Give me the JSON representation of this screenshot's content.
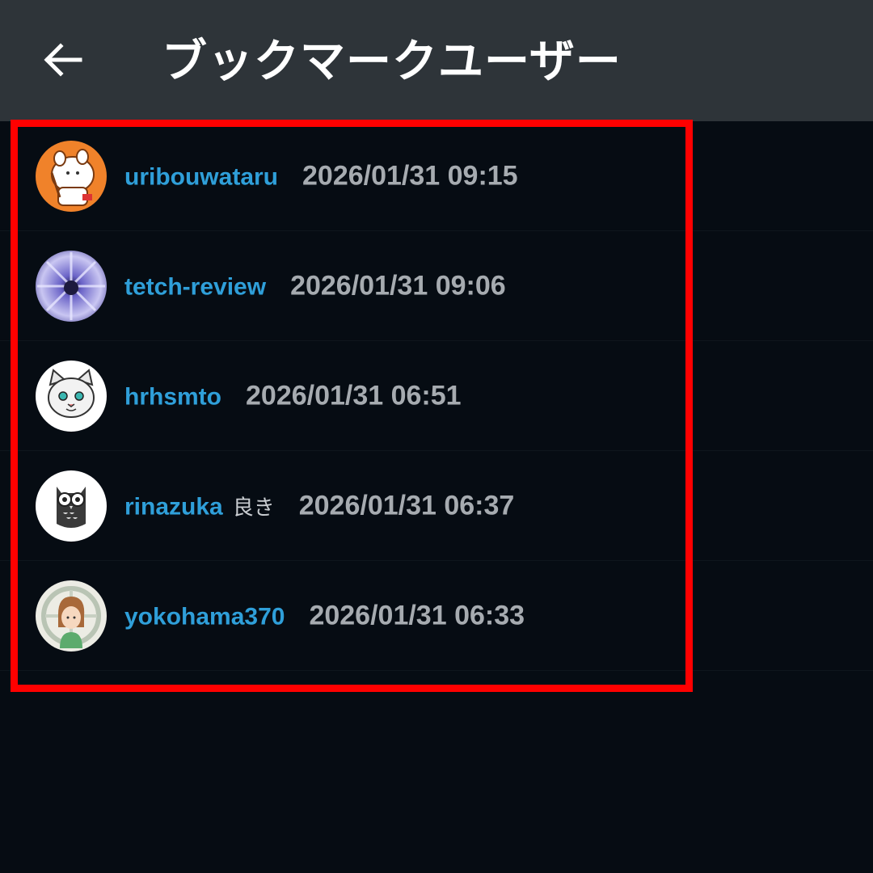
{
  "header": {
    "title": "ブックマークユーザー",
    "back_icon": "arrow-left-icon"
  },
  "colors": {
    "header_bg": "#2e3439",
    "page_bg": "#060c13",
    "username": "#2f9fd9",
    "timestamp": "#a6abb0",
    "highlight": "#ff0000"
  },
  "users": [
    {
      "username": "uribouwataru",
      "comment": "",
      "timestamp": "2026/01/31 09:15",
      "avatar": "cartoon-boar-avatar"
    },
    {
      "username": "tetch-review",
      "comment": "",
      "timestamp": "2026/01/31 09:06",
      "avatar": "purple-flower-avatar"
    },
    {
      "username": "hrhsmto",
      "comment": "",
      "timestamp": "2026/01/31 06:51",
      "avatar": "white-cat-avatar"
    },
    {
      "username": "rinazuka",
      "comment": "良き",
      "timestamp": "2026/01/31 06:37",
      "avatar": "owl-avatar"
    },
    {
      "username": "yokohama370",
      "comment": "",
      "timestamp": "2026/01/31 06:33",
      "avatar": "girl-portrait-avatar"
    }
  ]
}
